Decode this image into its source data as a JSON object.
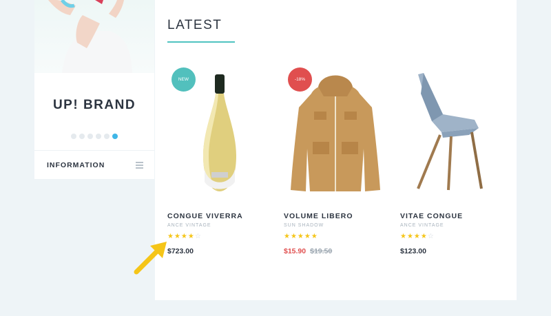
{
  "sidebar": {
    "brand_title": "UP! BRAND",
    "slider_dots": [
      false,
      false,
      false,
      false,
      false,
      true
    ],
    "info_label": "INFORMATION",
    "menu_icon": "hamburger-icon"
  },
  "section": {
    "title": "LATEST"
  },
  "products": [
    {
      "name": "CONGUE VIVERRA",
      "brand": "ANCE VINTAGE",
      "rating": 4,
      "rating_max": 5,
      "price": "$723.00",
      "old_price": "",
      "badge": "NEW",
      "badge_type": "new",
      "image": "wine-bottle"
    },
    {
      "name": "VOLUME LIBERO",
      "brand": "SUN SHADOW",
      "rating": 5,
      "rating_max": 5,
      "price": "$15.90",
      "old_price": "$19.50",
      "badge": "-18%",
      "badge_type": "sale",
      "image": "jacket"
    },
    {
      "name": "VITAE CONGUE",
      "brand": "ANCE VINTAGE",
      "rating": 4,
      "rating_max": 5,
      "price": "$123.00",
      "old_price": "",
      "badge": "",
      "badge_type": "",
      "image": "chair"
    }
  ],
  "colors": {
    "accent": "#4fc3c0",
    "sale": "#e04f4f",
    "new_badge": "#52c0bd",
    "star": "#f5c518",
    "dot_active": "#3fb6e7",
    "arrow": "#f5c518"
  }
}
